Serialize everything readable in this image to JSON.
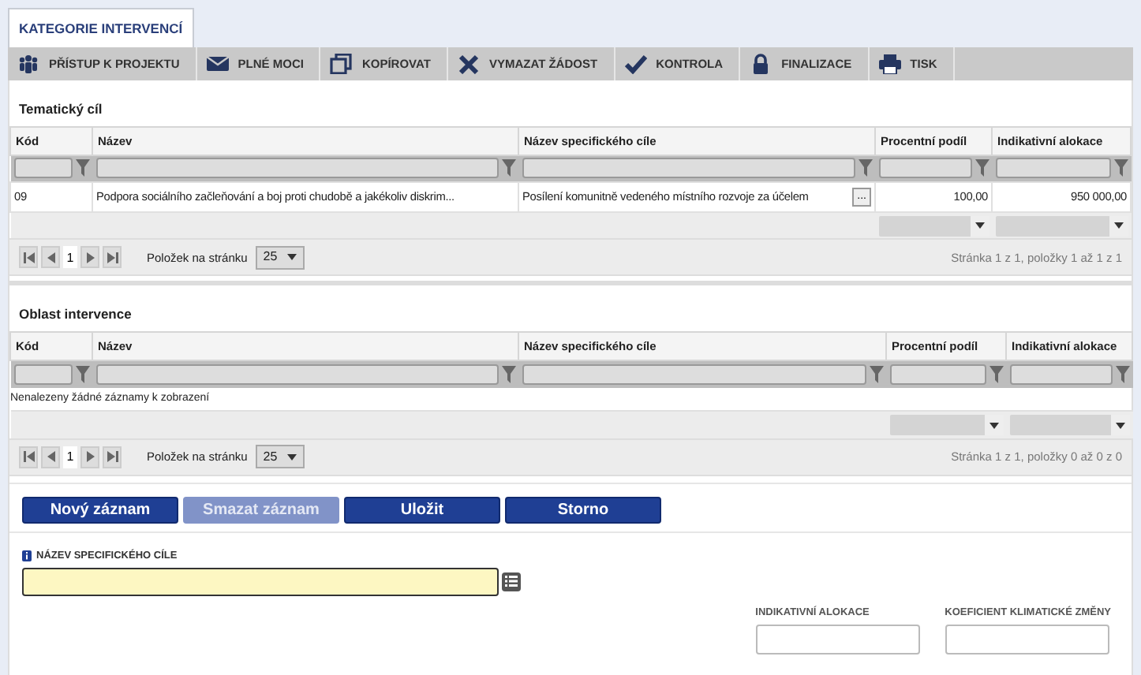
{
  "tabs": [
    {
      "label": "KATEGORIE INTERVENCÍ",
      "selected": true
    }
  ],
  "toolbar": [
    {
      "label": "PŘÍSTUP K PROJEKTU"
    },
    {
      "label": "PLNÉ MOCI"
    },
    {
      "label": "KOPÍROVAT"
    },
    {
      "label": "VYMAZAT ŽÁDOST"
    },
    {
      "label": "KONTROLA"
    },
    {
      "label": "FINALIZACE"
    },
    {
      "label": "TISK"
    }
  ],
  "sections": [
    {
      "title": "Tematický cíl",
      "columns": [
        "Kód",
        "Název",
        "Název specifického cíle",
        "Procentní podíl",
        "Indikativní alokace"
      ],
      "rows": [
        {
          "cells": [
            "09",
            "Podpora sociálního začleňování a boj proti chudobě a jakékoliv diskrim...",
            "Posílení komunitně vedeného místního rozvoje za účelem",
            "100,00",
            "950 000,00"
          ],
          "more": "..."
        }
      ],
      "pager": {
        "page": "1",
        "per_page_label": "Položek na stránku",
        "per_page": "25",
        "summary": "Stránka 1 z 1, položky 1 až 1 z 1"
      }
    },
    {
      "title": "Oblast intervence",
      "columns": [
        "Kód",
        "Název",
        "Název specifického cíle",
        "Procentní podíl",
        "Indikativní alokace"
      ],
      "empty_message": "Nenalezeny žádné záznamy k zobrazení",
      "pager": {
        "page": "1",
        "per_page_label": "Položek na stránku",
        "per_page": "25",
        "summary": "Stránka 1 z 1, položky 0 až 0 z 0"
      }
    }
  ],
  "buttons": [
    {
      "label": "Nový záznam",
      "disabled": false
    },
    {
      "label": "Smazat záznam",
      "disabled": true
    },
    {
      "label": "Uložit",
      "disabled": false
    },
    {
      "label": "Storno",
      "disabled": false
    }
  ],
  "form": {
    "main_field": {
      "label": "NÁZEV SPECIFICKÉHO CÍLE",
      "required": true
    },
    "fields": [
      {
        "label": "INDIKATIVNÍ ALOKACE"
      },
      {
        "label": "KOEFICIENT KLIMATICKÉ ZMĚNY"
      }
    ]
  }
}
